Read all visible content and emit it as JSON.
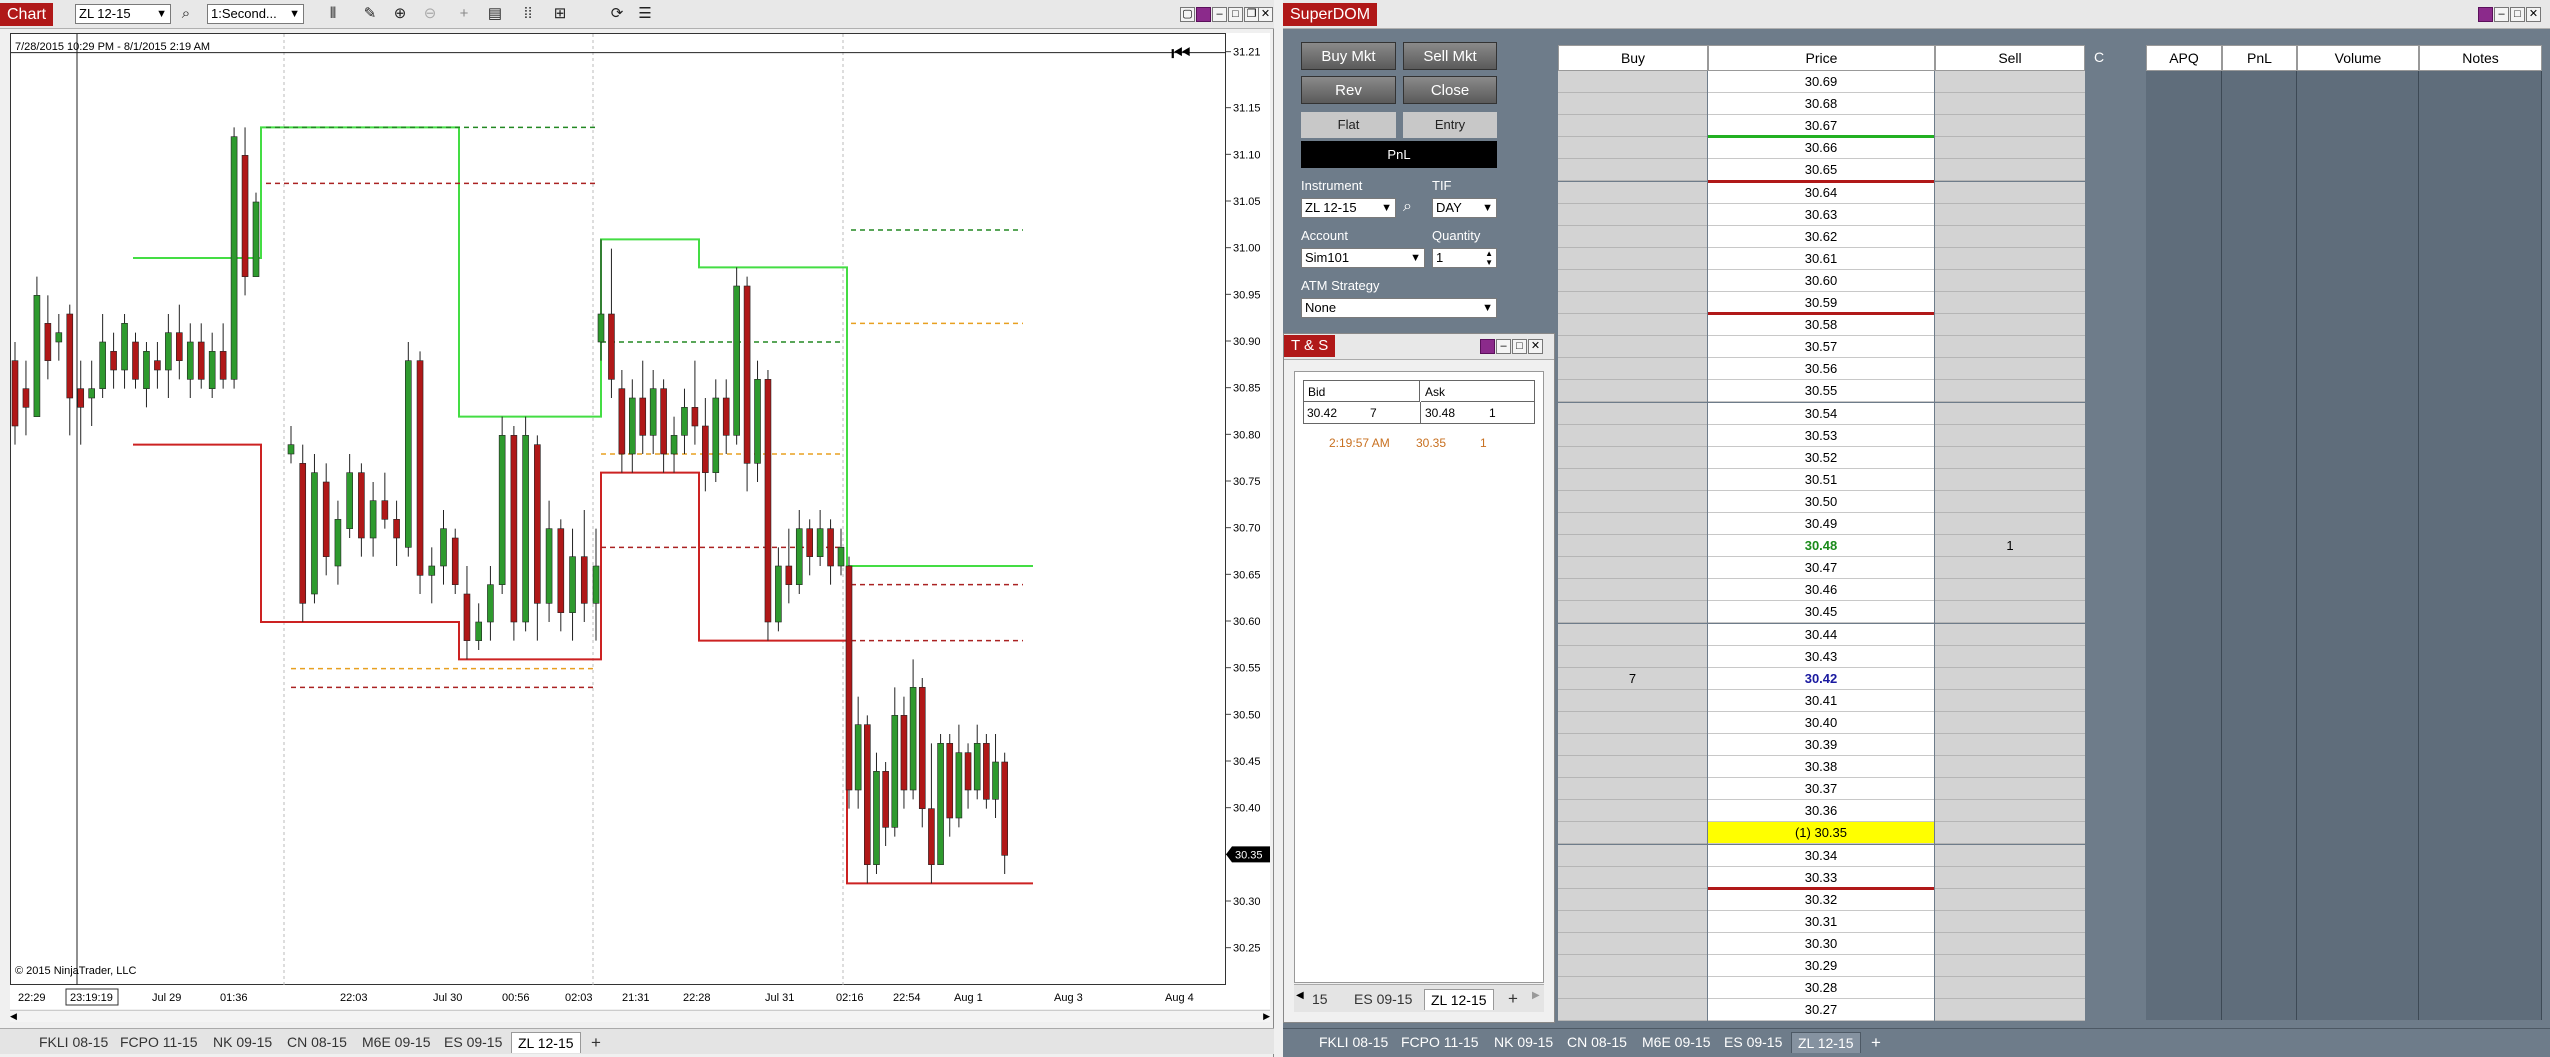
{
  "chart_window": {
    "title": "Chart",
    "instrument": "ZL 12-15",
    "interval": "1:Second...",
    "date_range": "7/28/2015 10:29 PM - 8/1/2015 2:19 AM",
    "copyright": "© 2015 NinjaTrader, LLC",
    "icons": [
      "bar-style-icon",
      "draw-pencil-icon",
      "zoom-in-icon",
      "zoom-out-icon",
      "crosshair-icon",
      "properties-icon",
      "indicator-icon",
      "strategy-icon",
      "refresh-icon",
      "list-icon"
    ],
    "tabs": [
      "FKLI 08-15",
      "FCPO 11-15",
      "NK 09-15",
      "CN 08-15",
      "M6E 09-15",
      "ES 09-15",
      "ZL 12-15"
    ],
    "active_tab": "ZL 12-15",
    "add_tab": "+"
  },
  "chart_data": {
    "type": "candlestick",
    "ylim": [
      30.21,
      31.23
    ],
    "y_ticks": [
      "31.21",
      "31.15",
      "31.10",
      "31.05",
      "31.00",
      "30.95",
      "30.90",
      "30.85",
      "30.80",
      "30.75",
      "30.70",
      "30.65",
      "30.60",
      "30.55",
      "30.50",
      "30.45",
      "30.40",
      "30.35",
      "30.30",
      "30.25"
    ],
    "y_values": [
      31.21,
      31.15,
      31.1,
      31.05,
      31.0,
      30.95,
      30.9,
      30.85,
      30.8,
      30.75,
      30.7,
      30.65,
      30.6,
      30.55,
      30.5,
      30.45,
      30.4,
      30.35,
      30.3,
      30.25
    ],
    "last_price": "30.35",
    "x_ticks": [
      "22:29",
      "23:19:19",
      "Jul 29",
      "01:36",
      "22:03",
      "Jul 30",
      "00:56",
      "02:03",
      "21:31",
      "22:28",
      "Jul 31",
      "02:16",
      "22:54",
      "Aug 1",
      "Aug 3",
      "Aug 4"
    ],
    "up_color": "#2e9a2e",
    "down_color": "#b01818",
    "candles": [
      [
        30.88,
        30.9,
        30.79,
        30.81
      ],
      [
        30.85,
        30.88,
        30.8,
        30.83
      ],
      [
        30.82,
        30.97,
        30.82,
        30.95
      ],
      [
        30.92,
        30.95,
        30.86,
        30.88
      ],
      [
        30.9,
        30.93,
        30.88,
        30.91
      ],
      [
        30.93,
        30.94,
        30.8,
        30.84
      ],
      [
        30.85,
        30.88,
        30.79,
        30.83
      ],
      [
        30.84,
        30.88,
        30.81,
        30.85
      ],
      [
        30.85,
        30.93,
        30.84,
        30.9
      ],
      [
        30.89,
        30.91,
        30.85,
        30.87
      ],
      [
        30.87,
        30.93,
        30.85,
        30.92
      ],
      [
        30.9,
        30.91,
        30.85,
        30.86
      ],
      [
        30.85,
        30.9,
        30.83,
        30.89
      ],
      [
        30.88,
        30.9,
        30.85,
        30.87
      ],
      [
        30.87,
        30.93,
        30.84,
        30.91
      ],
      [
        30.91,
        30.94,
        30.86,
        30.88
      ],
      [
        30.86,
        30.92,
        30.84,
        30.9
      ],
      [
        30.9,
        30.92,
        30.85,
        30.86
      ],
      [
        30.85,
        30.91,
        30.84,
        30.89
      ],
      [
        30.89,
        30.92,
        30.85,
        30.86
      ],
      [
        30.86,
        31.13,
        30.85,
        31.12
      ],
      [
        31.1,
        31.13,
        30.95,
        30.97
      ],
      [
        30.97,
        31.06,
        30.99,
        31.05
      ],
      [
        30.78,
        30.81,
        30.77,
        30.79
      ],
      [
        30.77,
        30.79,
        30.6,
        30.62
      ],
      [
        30.63,
        30.78,
        30.62,
        30.76
      ],
      [
        30.75,
        30.77,
        30.65,
        30.67
      ],
      [
        30.66,
        30.73,
        30.64,
        30.71
      ],
      [
        30.7,
        30.78,
        30.69,
        30.76
      ],
      [
        30.76,
        30.77,
        30.67,
        30.69
      ],
      [
        30.69,
        30.75,
        30.67,
        30.73
      ],
      [
        30.73,
        30.76,
        30.7,
        30.71
      ],
      [
        30.71,
        30.73,
        30.66,
        30.69
      ],
      [
        30.68,
        30.9,
        30.67,
        30.88
      ],
      [
        30.88,
        30.89,
        30.63,
        30.65
      ],
      [
        30.65,
        30.68,
        30.62,
        30.66
      ],
      [
        30.66,
        30.72,
        30.64,
        30.7
      ],
      [
        30.69,
        30.7,
        30.63,
        30.64
      ],
      [
        30.63,
        30.66,
        30.56,
        30.58
      ],
      [
        30.58,
        30.62,
        30.57,
        30.6
      ],
      [
        30.6,
        30.66,
        30.58,
        30.64
      ],
      [
        30.64,
        30.82,
        30.63,
        30.8
      ],
      [
        30.8,
        30.81,
        30.58,
        30.6
      ],
      [
        30.6,
        30.82,
        30.59,
        30.8
      ],
      [
        30.79,
        30.8,
        30.58,
        30.62
      ],
      [
        30.62,
        30.73,
        30.6,
        30.7
      ],
      [
        30.7,
        30.71,
        30.59,
        30.61
      ],
      [
        30.61,
        30.7,
        30.58,
        30.67
      ],
      [
        30.67,
        30.72,
        30.6,
        30.62
      ],
      [
        30.62,
        30.7,
        30.58,
        30.66
      ],
      [
        30.9,
        31.01,
        30.88,
        30.93
      ],
      [
        30.93,
        31.0,
        30.84,
        30.86
      ],
      [
        30.85,
        30.87,
        30.76,
        30.78
      ],
      [
        30.78,
        30.86,
        30.76,
        30.84
      ],
      [
        30.84,
        30.88,
        30.78,
        30.8
      ],
      [
        30.8,
        30.87,
        30.78,
        30.85
      ],
      [
        30.85,
        30.86,
        30.76,
        30.78
      ],
      [
        30.78,
        30.82,
        30.76,
        30.8
      ],
      [
        30.8,
        30.85,
        30.78,
        30.83
      ],
      [
        30.83,
        30.88,
        30.79,
        30.81
      ],
      [
        30.81,
        30.84,
        30.74,
        30.76
      ],
      [
        30.76,
        30.86,
        30.75,
        30.84
      ],
      [
        30.84,
        30.86,
        30.78,
        30.8
      ],
      [
        30.8,
        30.98,
        30.79,
        30.96
      ],
      [
        30.96,
        30.97,
        30.74,
        30.77
      ],
      [
        30.77,
        30.88,
        30.75,
        30.86
      ],
      [
        30.86,
        30.87,
        30.58,
        30.6
      ],
      [
        30.6,
        30.68,
        30.59,
        30.66
      ],
      [
        30.66,
        30.7,
        30.62,
        30.64
      ],
      [
        30.64,
        30.72,
        30.63,
        30.7
      ],
      [
        30.7,
        30.71,
        30.65,
        30.67
      ],
      [
        30.67,
        30.72,
        30.66,
        30.7
      ],
      [
        30.7,
        30.71,
        30.64,
        30.66
      ],
      [
        30.66,
        30.7,
        30.65,
        30.68
      ],
      [
        30.66,
        30.67,
        30.4,
        30.42
      ],
      [
        30.42,
        30.52,
        30.4,
        30.49
      ],
      [
        30.49,
        30.5,
        30.32,
        30.34
      ],
      [
        30.34,
        30.46,
        30.33,
        30.44
      ],
      [
        30.44,
        30.45,
        30.36,
        30.38
      ],
      [
        30.38,
        30.53,
        30.37,
        30.5
      ],
      [
        30.5,
        30.52,
        30.4,
        30.42
      ],
      [
        30.42,
        30.56,
        30.41,
        30.53
      ],
      [
        30.53,
        30.54,
        30.38,
        30.4
      ],
      [
        30.4,
        30.47,
        30.32,
        30.34
      ],
      [
        30.34,
        30.48,
        30.34,
        30.47
      ],
      [
        30.47,
        30.48,
        30.37,
        30.39
      ],
      [
        30.39,
        30.49,
        30.38,
        30.46
      ],
      [
        30.46,
        30.47,
        30.4,
        30.42
      ],
      [
        30.42,
        30.49,
        30.41,
        30.47
      ],
      [
        30.47,
        30.48,
        30.4,
        30.41
      ],
      [
        30.41,
        30.48,
        30.39,
        30.45
      ],
      [
        30.45,
        30.46,
        30.33,
        30.35
      ]
    ]
  },
  "superdom": {
    "title": "SuperDOM",
    "buttons": {
      "buy_mkt": "Buy Mkt",
      "sell_mkt": "Sell Mkt",
      "rev": "Rev",
      "close": "Close"
    },
    "flat_label": "Flat",
    "entry_label": "Entry",
    "pnl_label": "PnL",
    "instrument_label": "Instrument",
    "instrument_value": "ZL 12-15",
    "tif_label": "TIF",
    "tif_value": "DAY",
    "account_label": "Account",
    "account_value": "Sim101",
    "quantity_label": "Quantity",
    "quantity_value": "1",
    "atm_label": "ATM Strategy",
    "atm_value": "None",
    "headers": {
      "buy": "Buy",
      "price": "Price",
      "sell": "Sell",
      "c": "C",
      "apq": "APQ",
      "pnl": "PnL",
      "volume": "Volume",
      "notes": "Notes"
    },
    "rows": [
      {
        "price": "30.69"
      },
      {
        "price": "30.68"
      },
      {
        "price": "30.67"
      },
      {
        "price": "30.66"
      },
      {
        "price": "30.65"
      },
      {
        "price": "30.64"
      },
      {
        "price": "30.63"
      },
      {
        "price": "30.62"
      },
      {
        "price": "30.61"
      },
      {
        "price": "30.60"
      },
      {
        "price": "30.59"
      },
      {
        "price": "30.58"
      },
      {
        "price": "30.57"
      },
      {
        "price": "30.56"
      },
      {
        "price": "30.55"
      },
      {
        "price": "30.54"
      },
      {
        "price": "30.53"
      },
      {
        "price": "30.52"
      },
      {
        "price": "30.51"
      },
      {
        "price": "30.50"
      },
      {
        "price": "30.49"
      },
      {
        "price": "30.48",
        "sell": "1",
        "style": "ask"
      },
      {
        "price": "30.47"
      },
      {
        "price": "30.46"
      },
      {
        "price": "30.45"
      },
      {
        "price": "30.44"
      },
      {
        "price": "30.43"
      },
      {
        "price": "30.42",
        "buy": "7",
        "style": "bid"
      },
      {
        "price": "30.41"
      },
      {
        "price": "30.40"
      },
      {
        "price": "30.39"
      },
      {
        "price": "30.38"
      },
      {
        "price": "30.37"
      },
      {
        "price": "30.36"
      },
      {
        "price": "(1) 30.35",
        "style": "last"
      },
      {
        "price": "30.34"
      },
      {
        "price": "30.33"
      },
      {
        "price": "30.32"
      },
      {
        "price": "30.31"
      },
      {
        "price": "30.30"
      },
      {
        "price": "30.29"
      },
      {
        "price": "30.28"
      },
      {
        "price": "30.27"
      }
    ],
    "tabs": [
      "FKLI 08-15",
      "FCPO 11-15",
      "NK 09-15",
      "CN 08-15",
      "M6E 09-15",
      "ES 09-15",
      "ZL 12-15"
    ],
    "active_tab": "ZL 12-15",
    "add_tab": "+"
  },
  "time_and_sales": {
    "title": "T & S",
    "bid_label": "Bid",
    "ask_label": "Ask",
    "bid_price": "30.42",
    "bid_size": "7",
    "ask_price": "30.48",
    "ask_size": "1",
    "trade_time": "2:19:57 AM",
    "trade_price": "30.35",
    "trade_size": "1",
    "trade_color": "#c87020",
    "tabs": [
      "15",
      "ES 09-15",
      "ZL 12-15"
    ],
    "active_tab": "ZL 12-15",
    "add_tab": "+"
  }
}
